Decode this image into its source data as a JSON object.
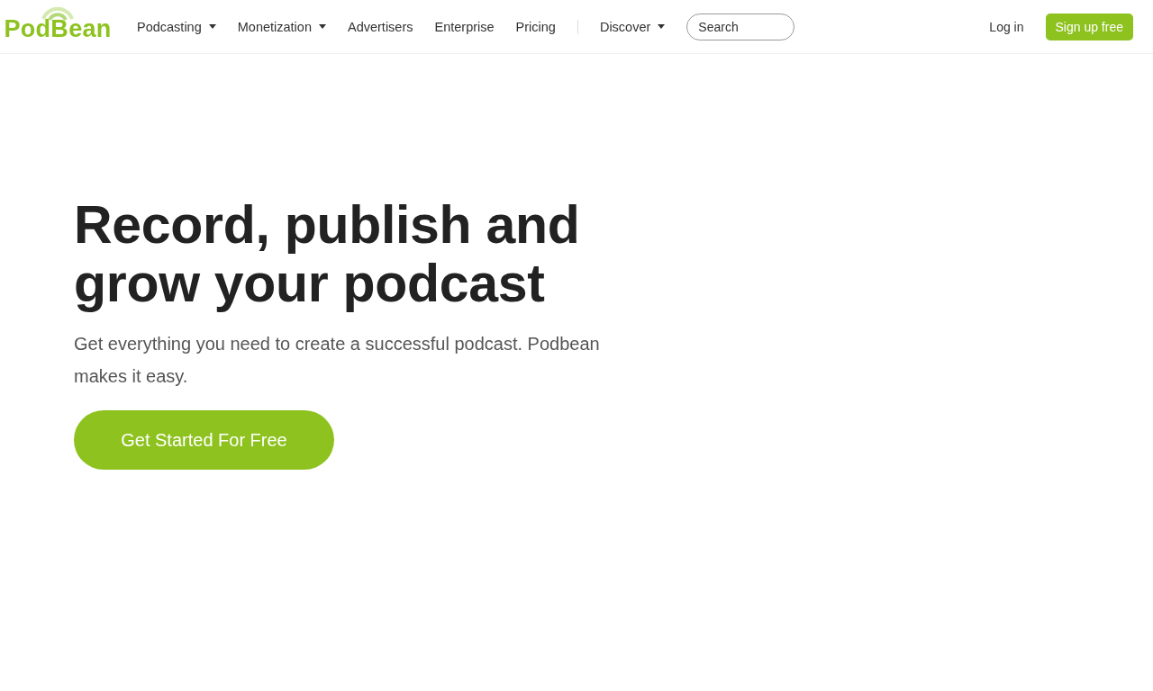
{
  "header": {
    "logo": "PodBean",
    "nav": [
      {
        "label": "Podcasting",
        "dropdown": true
      },
      {
        "label": "Monetization",
        "dropdown": true
      },
      {
        "label": "Advertisers",
        "dropdown": false
      },
      {
        "label": "Enterprise",
        "dropdown": false
      },
      {
        "label": "Pricing",
        "dropdown": false
      }
    ],
    "nav_secondary": [
      {
        "label": "Discover",
        "dropdown": true
      }
    ],
    "search": {
      "placeholder": "Search"
    },
    "login": "Log in",
    "signup": "Sign up free"
  },
  "hero": {
    "title": "Record, publish and grow your podcast",
    "subtitle": "Get everything you need to create a successful podcast. Podbean makes it easy.",
    "cta": "Get Started For Free"
  }
}
